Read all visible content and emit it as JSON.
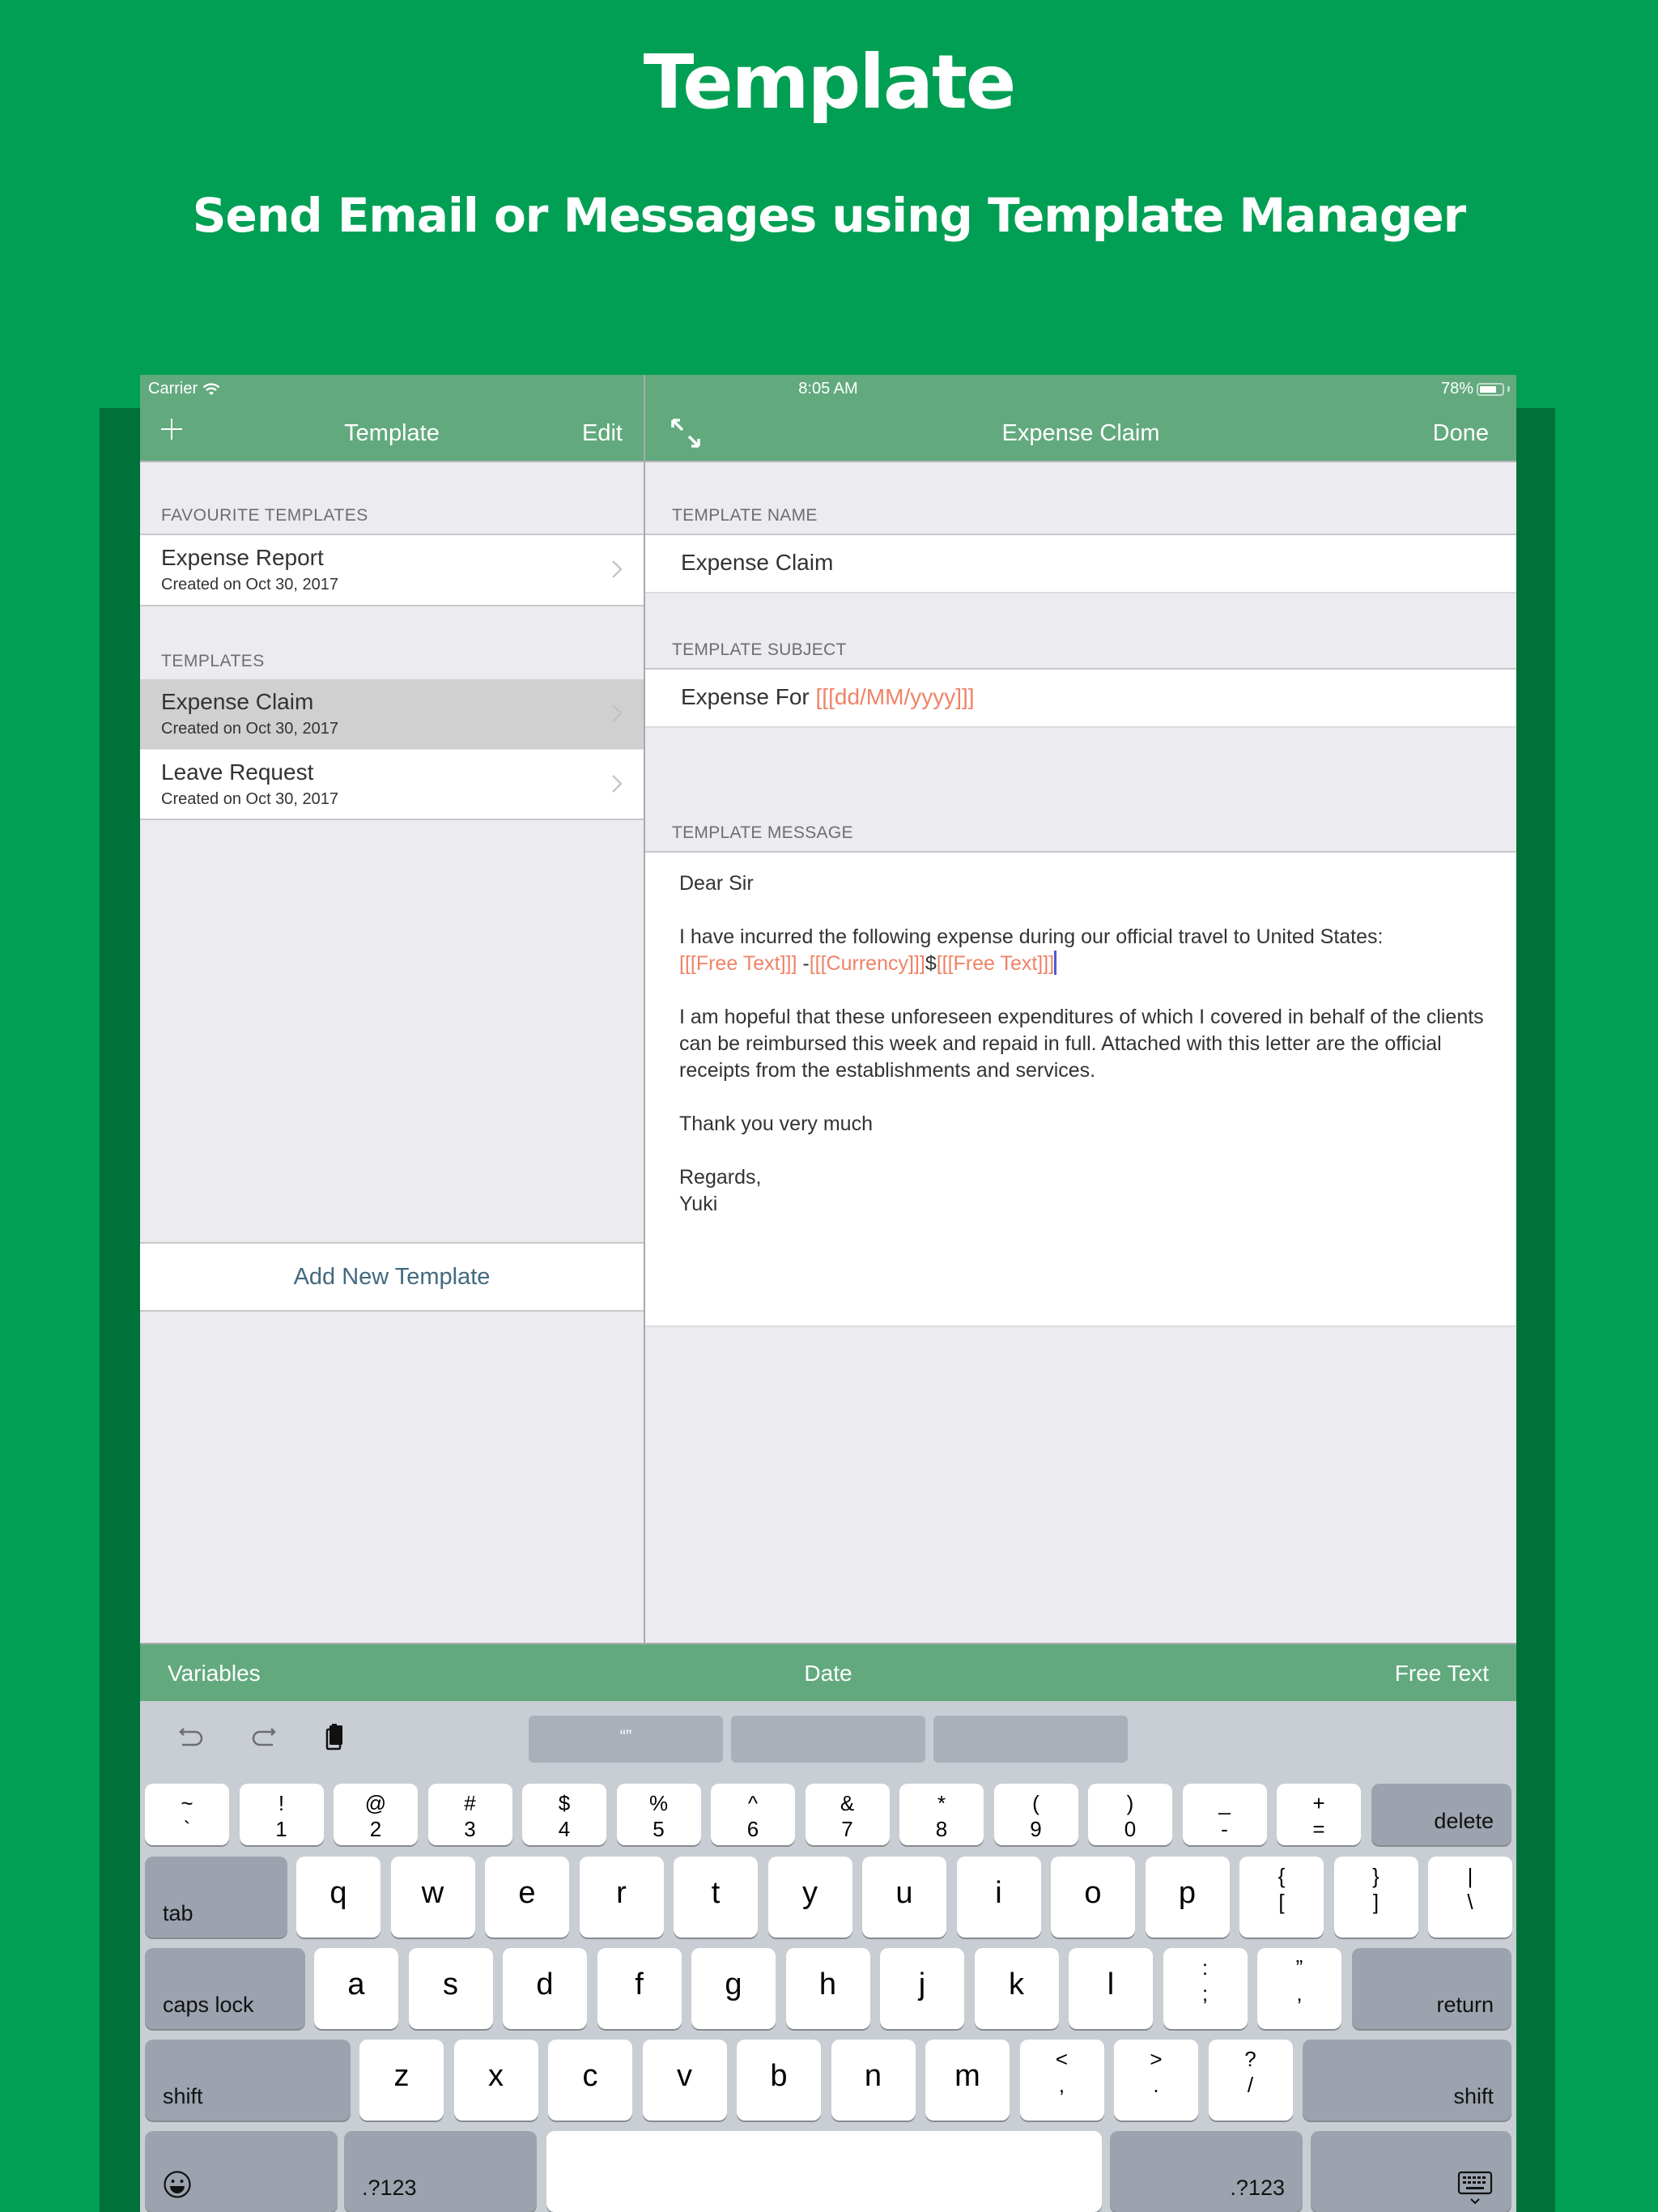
{
  "hero": {
    "title": "Template",
    "subtitle": "Send Email or Messages using Template Manager"
  },
  "status_bar": {
    "carrier": "Carrier",
    "time": "8:05 AM",
    "battery": "78%",
    "battery_level": 0.78
  },
  "left_nav": {
    "title": "Template",
    "edit_label": "Edit",
    "add_icon": "plus-icon"
  },
  "right_nav": {
    "title": "Expense Claim",
    "done_label": "Done",
    "expand_icon": "expand-arrows-icon"
  },
  "sidebar": {
    "favourites_header": "FAVOURITE TEMPLATES",
    "favourites": [
      {
        "title": "Expense Report",
        "subtitle": "Created on Oct 30, 2017",
        "selected": false
      }
    ],
    "templates_header": "TEMPLATES",
    "templates": [
      {
        "title": "Expense Claim",
        "subtitle": "Created on Oct 30, 2017",
        "selected": true
      },
      {
        "title": "Leave Request",
        "subtitle": "Created on Oct 30, 2017",
        "selected": false
      }
    ],
    "add_button": "Add New Template"
  },
  "editor": {
    "name_header": "TEMPLATE NAME",
    "name_value": "Expense Claim",
    "subject_header": "TEMPLATE SUBJECT",
    "subject_text": "Expense For ",
    "subject_variable": "[[[dd/MM/yyyy]]]",
    "message_header": "TEMPLATE MESSAGE",
    "message": {
      "greeting": "Dear Sir",
      "line1": "I have incurred the following expense during our official travel to United States:",
      "var1": "[[[Free Text]]]",
      "sep1": " -",
      "var2": "[[[Currency]]]",
      "sep2": "$",
      "var3": "[[[Free Text]]]",
      "paragraph2": "I am hopeful that these unforeseen expenditures of which I covered in behalf of the clients can be reimbursed this week and repaid in full. Attached with this letter are the official receipts from the establishments and services.",
      "thanks": "Thank you very much",
      "regards": "Regards,",
      "signature": "Yuki"
    },
    "variable_color": "#ef8366"
  },
  "accessory_bar": {
    "variables": "Variables",
    "date": "Date",
    "free_text": "Free Text"
  },
  "keyboard": {
    "shortcuts": [
      "undo-icon",
      "redo-icon",
      "paste-icon"
    ],
    "suggestions": [
      "“”",
      "",
      ""
    ],
    "row1": [
      {
        "top": "~",
        "bottom": "`"
      },
      {
        "top": "!",
        "bottom": "1"
      },
      {
        "top": "@",
        "bottom": "2"
      },
      {
        "top": "#",
        "bottom": "3"
      },
      {
        "top": "$",
        "bottom": "4"
      },
      {
        "top": "%",
        "bottom": "5"
      },
      {
        "top": "^",
        "bottom": "6"
      },
      {
        "top": "&",
        "bottom": "7"
      },
      {
        "top": "*",
        "bottom": "8"
      },
      {
        "top": "(",
        "bottom": "9"
      },
      {
        "top": ")",
        "bottom": "0"
      },
      {
        "top": "_",
        "bottom": "-"
      },
      {
        "top": "+",
        "bottom": "="
      }
    ],
    "delete": "delete",
    "tab": "tab",
    "row2": [
      "q",
      "w",
      "e",
      "r",
      "t",
      "y",
      "u",
      "i",
      "o",
      "p"
    ],
    "row2_extra": [
      {
        "top": "{",
        "bottom": "["
      },
      {
        "top": "}",
        "bottom": "]"
      },
      {
        "top": "|",
        "bottom": "\\"
      }
    ],
    "caps_lock": "caps lock",
    "row3": [
      "a",
      "s",
      "d",
      "f",
      "g",
      "h",
      "j",
      "k",
      "l"
    ],
    "row3_extra": [
      {
        "top": ":",
        "bottom": ";"
      },
      {
        "top": "”",
        "bottom": ","
      }
    ],
    "return": "return",
    "shift": "shift",
    "row4": [
      "z",
      "x",
      "c",
      "v",
      "b",
      "n",
      "m"
    ],
    "row4_extra": [
      {
        "top": "<",
        "bottom": ","
      },
      {
        "top": ">",
        "bottom": "."
      },
      {
        "top": "?",
        "bottom": "/"
      }
    ],
    "numbers_label": ".?123",
    "emoji_icon": "emoji-icon",
    "dismiss_icon": "keyboard-dismiss-icon"
  },
  "colors": {
    "background": "#019f53",
    "nav": "#62aa7e",
    "link": "#43697f"
  }
}
